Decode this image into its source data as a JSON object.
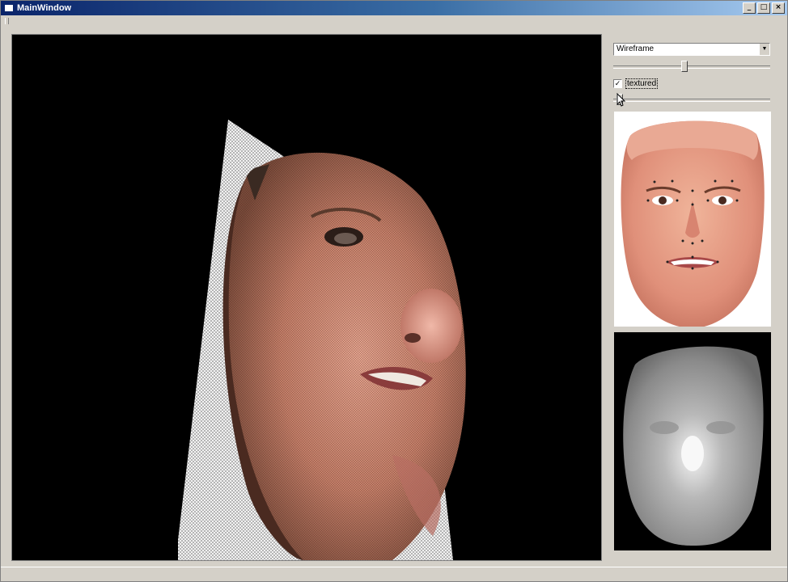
{
  "window": {
    "title": "MainWindow",
    "controls": {
      "minimize": "_",
      "maximize": "□",
      "close": "×"
    }
  },
  "viewport": {
    "background_color": "#000000",
    "subject": "textured 3D face mesh rendered as wireframe"
  },
  "sidebar": {
    "render_mode": {
      "selected": "Wireframe"
    },
    "slider1": {
      "value_fraction": 0.45
    },
    "textured": {
      "label": "textured",
      "checked": true,
      "check_glyph": "✓"
    },
    "slider2": {
      "value_fraction": 0.02
    },
    "icons": {
      "dropdown": "chevron-down-icon",
      "pointer": "mouse-pointer-icon"
    }
  }
}
